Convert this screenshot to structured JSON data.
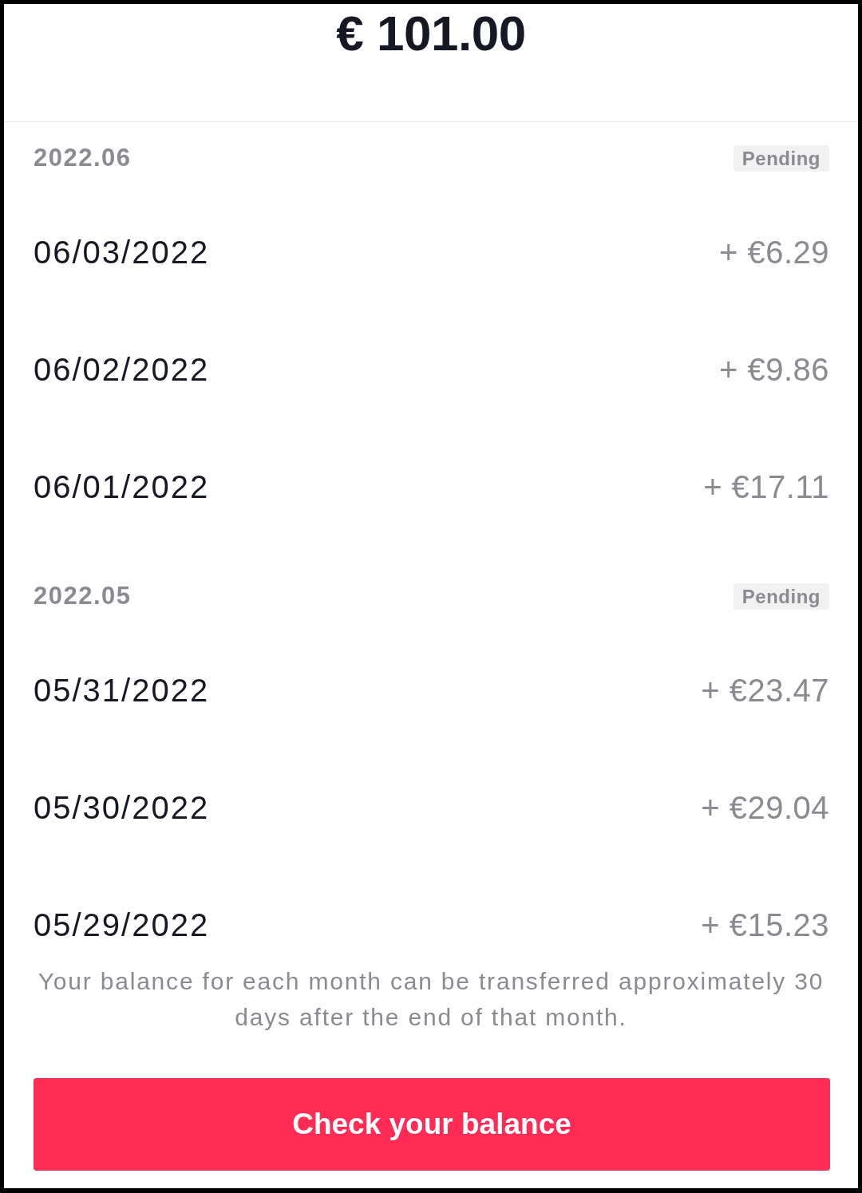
{
  "balance": "€ 101.00",
  "months": [
    {
      "label": "2022.06",
      "status": "Pending",
      "entries": [
        {
          "date": "06/03/2022",
          "amount": "+ €6.29"
        },
        {
          "date": "06/02/2022",
          "amount": "+ €9.86"
        },
        {
          "date": "06/01/2022",
          "amount": "+ €17.11"
        }
      ]
    },
    {
      "label": "2022.05",
      "status": "Pending",
      "entries": [
        {
          "date": "05/31/2022",
          "amount": "+ €23.47"
        },
        {
          "date": "05/30/2022",
          "amount": "+ €29.04"
        },
        {
          "date": "05/29/2022",
          "amount": "+ €15.23"
        }
      ]
    }
  ],
  "note": "Your balance for each month can be transferred approximately 30 days after the end of that month.",
  "button": {
    "label": "Check your balance"
  }
}
